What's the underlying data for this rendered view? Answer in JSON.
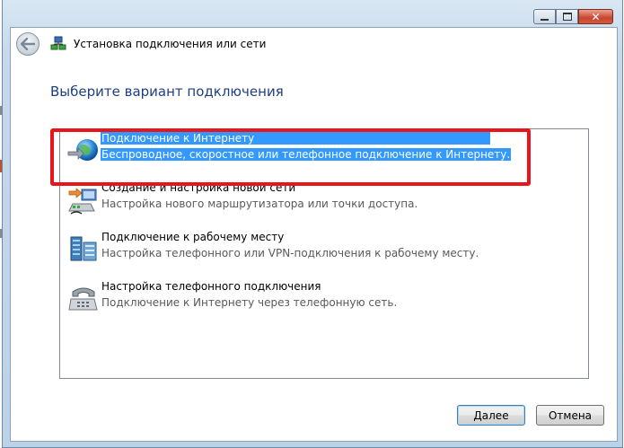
{
  "window": {
    "title": "Установка подключения или сети",
    "controls": [
      "minimize-icon",
      "maximize-icon",
      "close-icon"
    ]
  },
  "heading": "Выберите вариант подключения",
  "options": [
    {
      "icon": "globe-connection-icon",
      "title": "Подключение к Интернету",
      "description": "Беспроводное, скоростное или телефонное подключение к Интернету.",
      "selected": true
    },
    {
      "icon": "network-setup-icon",
      "title": "Создание и настройка новой сети",
      "description": "Настройка нового маршрутизатора или точки доступа.",
      "selected": false
    },
    {
      "icon": "workplace-icon",
      "title": "Подключение к рабочему месту",
      "description": "Настройка телефонного или VPN-подключения к рабочему месту.",
      "selected": false
    },
    {
      "icon": "dialup-phone-icon",
      "title": "Настройка телефонного подключения",
      "description": "Подключение к Интернету через телефонную сеть.",
      "selected": false
    }
  ],
  "buttons": {
    "next": "Далее",
    "cancel": "Отмена"
  },
  "colors": {
    "selection": "#3399ff",
    "annotation_border": "#e8161b",
    "heading": "#1e3f84"
  }
}
